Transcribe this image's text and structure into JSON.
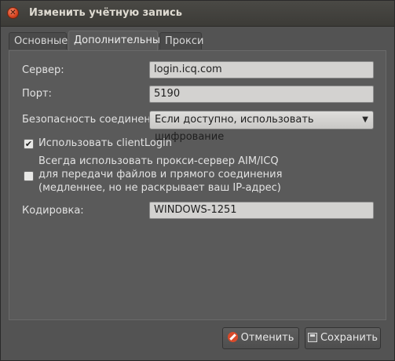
{
  "window": {
    "title": "Изменить учётную запись",
    "close_glyph": "✕"
  },
  "tabs": [
    {
      "label": "Основные",
      "active": false
    },
    {
      "label": "Дополнительные",
      "active": true
    },
    {
      "label": "Прокси",
      "active": false
    }
  ],
  "form": {
    "server_label": "Сервер:",
    "server_value": "login.icq.com",
    "port_label": "Порт:",
    "port_value": "5190",
    "security_label": "Безопасность соединения:",
    "security_value": "Если доступно, использовать шифрование",
    "clientlogin_label": "Использовать clientLogin",
    "clientlogin_checked": true,
    "proxy_line1": "Всегда использовать прокси-сервер AIM/ICQ",
    "proxy_line2": "для передачи файлов и прямого соединения",
    "proxy_line3": "(медленнее, но не раскрывает ваш IP-адрес)",
    "proxy_checked": false,
    "encoding_label": "Кодировка:",
    "encoding_value": "WINDOWS-1251"
  },
  "buttons": {
    "cancel_label": "Отменить",
    "cancel_icon": "cancel-icon",
    "save_label": "Сохранить",
    "save_icon": "save-icon"
  },
  "colors": {
    "background": "#535353",
    "titlebar": "#3c3b37",
    "close_button": "#d5421f"
  }
}
